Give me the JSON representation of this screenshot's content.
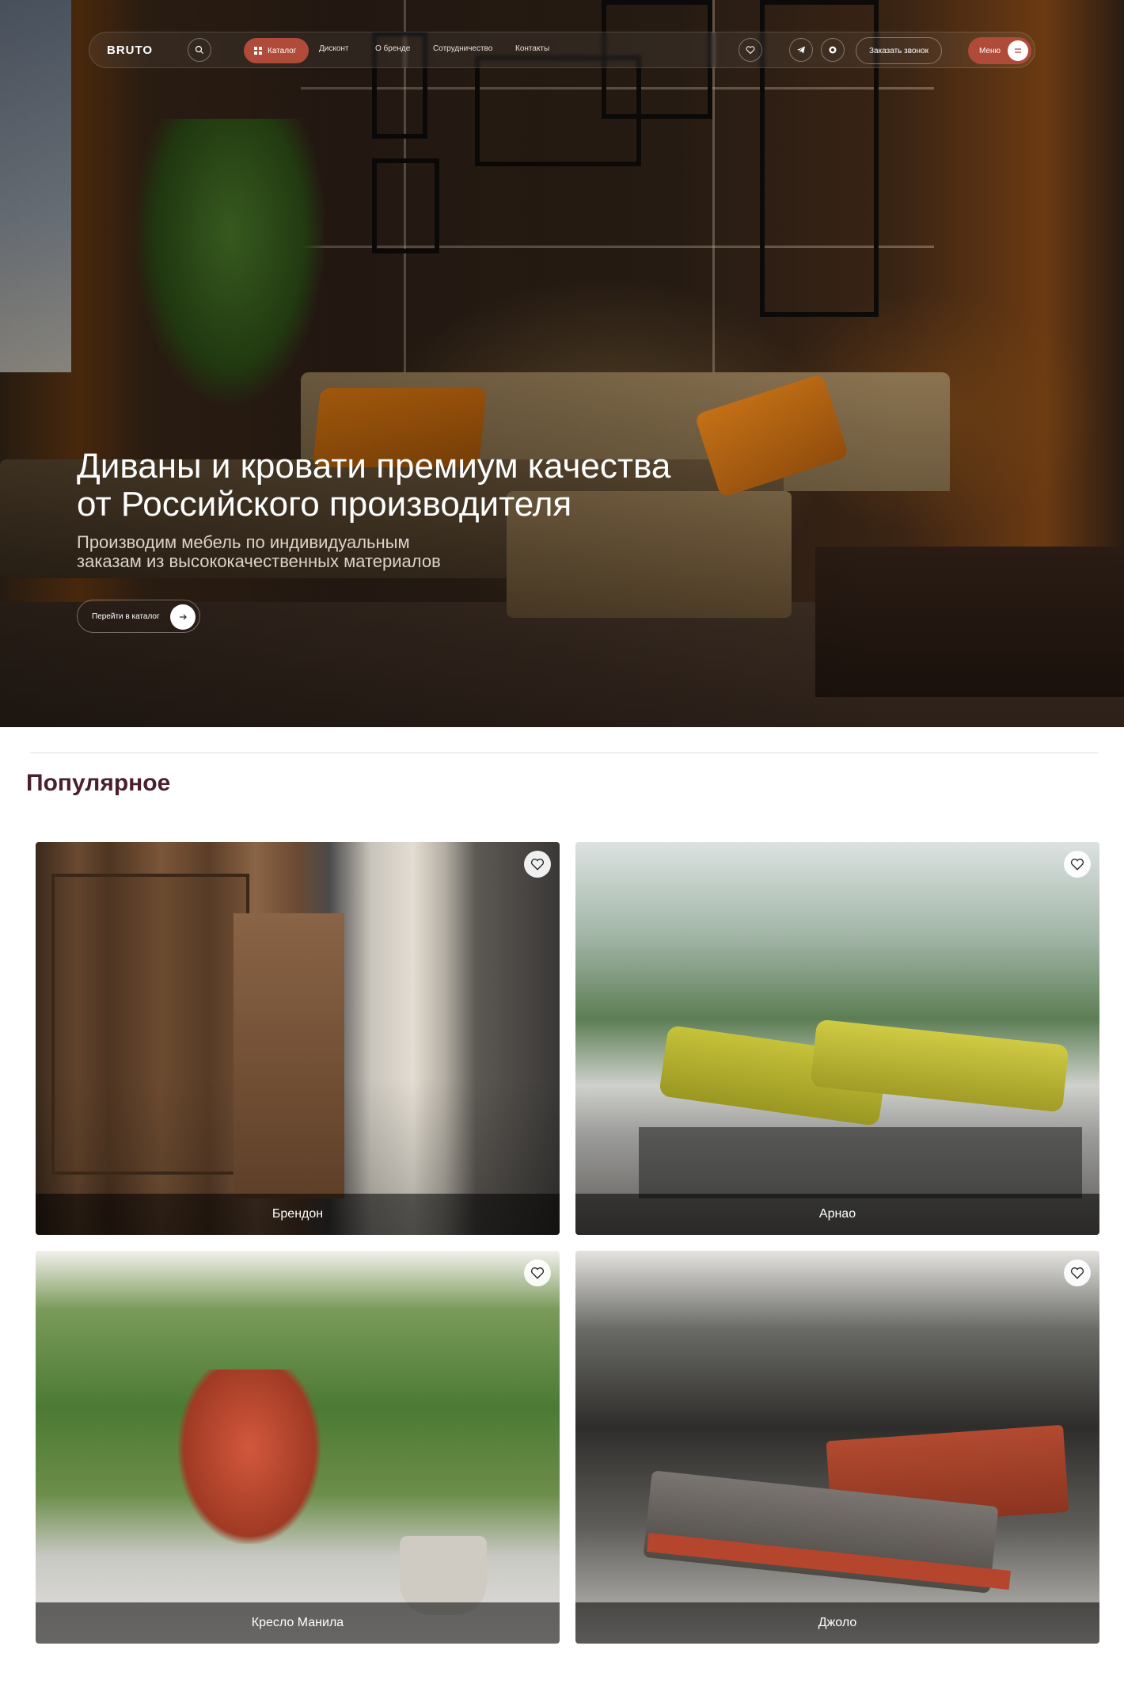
{
  "nav": {
    "logo": "BRUTO",
    "catalog": "Каталог",
    "links": [
      "Дисконт",
      "О бренде",
      "Сотрудничество",
      "Контакты"
    ],
    "call": "Заказать звонок",
    "menu": "Меню"
  },
  "hero": {
    "title_line1": "Диваны и кровати премиум качества",
    "title_line2": "от Российского производителя",
    "subtitle_line1": "Производим мебель по индивидуальным",
    "subtitle_line2": "заказам из высококачественных материалов",
    "cta": "Перейти в каталог"
  },
  "popular": {
    "title": "Популярное",
    "items": [
      {
        "name": "Брендон"
      },
      {
        "name": "Арнао"
      },
      {
        "name": "Кресло Манила"
      },
      {
        "name": "Джоло"
      }
    ]
  },
  "colors": {
    "accent": "#b04a39",
    "section_title": "#4a2030"
  },
  "icons": [
    "search-icon",
    "grid-icon",
    "heart-icon",
    "telegram-icon",
    "whatsapp-icon",
    "menu-icon",
    "arrow-right-icon"
  ]
}
